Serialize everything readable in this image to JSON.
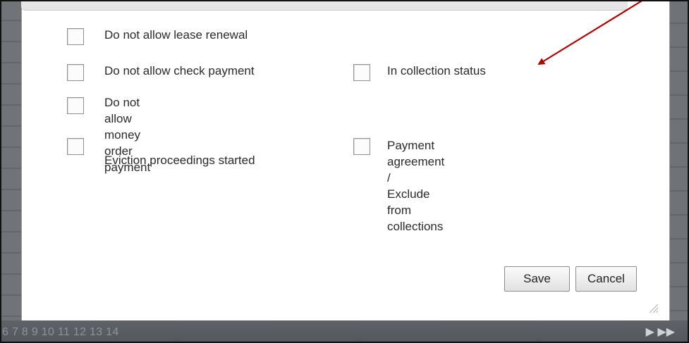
{
  "dialog": {
    "options": [
      {
        "label": "Do not allow lease renewal",
        "checked": false
      },
      {
        "label": "Do not allow check payment",
        "checked": false
      },
      {
        "label": "In collection status",
        "checked": false
      },
      {
        "label": "Do not allow money order\npayment",
        "checked": false
      },
      {
        "label": "Eviction proceedings started",
        "checked": false
      },
      {
        "label": "Payment agreement /\nExclude\nfrom collections",
        "checked": false
      }
    ],
    "save_label": "Save",
    "cancel_label": "Cancel"
  },
  "pagination": {
    "pages": "6 7 8 9 10 11 12 13 14",
    "next": "▶ ▶▶"
  },
  "annotation": {
    "arrow_color": "#b00000"
  }
}
